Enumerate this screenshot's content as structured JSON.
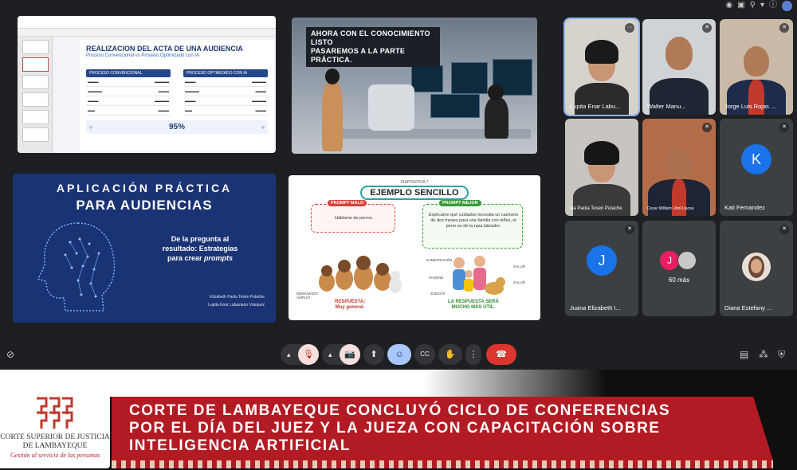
{
  "slides": {
    "acta": {
      "title": "REALIZACION DEL ACTA DE UNA AUDIENCIA",
      "subtitle": "Proceso Convencional vs Proceso Optimizado con IA",
      "col_left": "PROCESO CONVENCIONAL",
      "col_right": "PROCESO OPTIMIZADO CON IA",
      "stat": "95%"
    },
    "lab": {
      "banner_line1": "AHORA CON EL CONOCIMIENTO LISTO",
      "banner_line2": "PASAREMOS A LA PARTE PRÁCTICA."
    },
    "aplicacion": {
      "line1": "APLICACIÓN PRÁCTICA",
      "line2": "PARA AUDIENCIAS",
      "body1": "De la pregunta al",
      "body2": "resultado: Estrategias",
      "body3": "para crear",
      "body_em": "prompts",
      "author1": "Elizabeth Paola Tesén Pulache",
      "author2": "Lupita Enar Labaziano Vásquez"
    },
    "ejemplo": {
      "kicker": "DIAPOSITIVA 7",
      "title": "EJEMPLO SENCILLO",
      "bad_tag": "PROMPT MALO",
      "bad_text": "Háblame de perros.",
      "good_tag": "PROMPT MEJOR",
      "good_text": "Explícame qué cuidados necesita un cachorro de dos meses para una familia con niños, el perro es de la raza labrador.",
      "bad_answer1": "RESPUESTA:",
      "bad_answer2": "Muy general.",
      "good_answer1": "LA RESPUESTA SERÁ",
      "good_answer2": "MUCHO MÁS ÚTIL.",
      "side_left": "DEMASIADO AMPLIO",
      "side_items": [
        "ALIMENTACIÓN",
        "HIGIENE",
        "JUEGOS",
        "SALUD",
        "SALUD"
      ]
    }
  },
  "participants": [
    {
      "name": "Lupita Enar Labu...",
      "muted": false
    },
    {
      "name": "Walter Manu...",
      "muted": true
    },
    {
      "name": "Jorge Luis Rojas ...",
      "muted": true
    },
    {
      "name": "sia Paola Tesen Pulache",
      "muted": false
    },
    {
      "name": "Cesar William Uriol Llacsa",
      "muted": true
    },
    {
      "name": "Kati Fernandez",
      "initial": "K",
      "muted": true
    },
    {
      "name": "Juana Elizabeth I...",
      "initial": "J",
      "muted": true
    },
    {
      "name": "60 más",
      "initial": "J"
    },
    {
      "name": "Diana Estefany ...",
      "muted": true
    }
  ],
  "toolbar": {
    "mic": "🎙",
    "cam": "📷",
    "present": "⬆",
    "emoji": "☺",
    "captions": "CC",
    "hand": "✋",
    "more": "⋮",
    "end": "☎"
  },
  "banner": {
    "line1": "CORTE DE LAMBAYEQUE CONCLUYÓ CICLO DE CONFERENCIAS",
    "line2": "POR EL DÍA DEL JUEZ Y LA JUEZA CON CAPACITACIÓN SOBRE",
    "line3": "INTELIGENCIA ARTIFICIAL"
  },
  "logo": {
    "line1": "CORTE SUPERIOR DE JUSTICIA",
    "line2": "DE LAMBAYEQUE",
    "tagline": "Gestión al servicio de las personas"
  },
  "colors": {
    "accent_red": "#b31b24",
    "meet_bg": "#1e1f22",
    "tile_bg": "#3c4043",
    "slide_blue": "#1a3374"
  }
}
